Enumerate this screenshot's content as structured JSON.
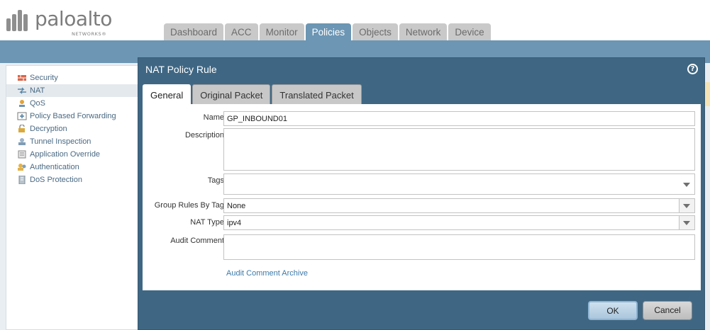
{
  "brand": {
    "name": "paloalto",
    "sub": "NETWORKS®"
  },
  "nav": {
    "tabs": [
      {
        "label": "Dashboard"
      },
      {
        "label": "ACC"
      },
      {
        "label": "Monitor"
      },
      {
        "label": "Policies",
        "active": true
      },
      {
        "label": "Objects"
      },
      {
        "label": "Network"
      },
      {
        "label": "Device"
      }
    ]
  },
  "sidebar": {
    "items": [
      {
        "label": "Security",
        "icon": "security-rule-icon"
      },
      {
        "label": "NAT",
        "icon": "nat-icon",
        "active": true
      },
      {
        "label": "QoS",
        "icon": "qos-icon"
      },
      {
        "label": "Policy Based Forwarding",
        "icon": "pbf-icon"
      },
      {
        "label": "Decryption",
        "icon": "lock-icon"
      },
      {
        "label": "Tunnel Inspection",
        "icon": "tunnel-icon"
      },
      {
        "label": "Application Override",
        "icon": "app-override-icon"
      },
      {
        "label": "Authentication",
        "icon": "users-icon"
      },
      {
        "label": "DoS Protection",
        "icon": "dos-protection-icon"
      }
    ]
  },
  "dialog": {
    "title": "NAT Policy Rule",
    "tabs": [
      {
        "label": "General",
        "active": true
      },
      {
        "label": "Original Packet"
      },
      {
        "label": "Translated Packet"
      }
    ],
    "fields": {
      "name": {
        "label": "Name",
        "value": "GP_INBOUND01"
      },
      "description": {
        "label": "Description",
        "value": ""
      },
      "tags": {
        "label": "Tags",
        "value": ""
      },
      "group_rules_by_tag": {
        "label": "Group Rules By Tag",
        "value": "None"
      },
      "nat_type": {
        "label": "NAT Type",
        "value": "ipv4"
      },
      "audit_comment": {
        "label": "Audit Comment",
        "value": ""
      }
    },
    "audit_comment_archive": "Audit Comment Archive",
    "ok_label": "OK",
    "cancel_label": "Cancel",
    "help_glyph": "?"
  },
  "colors": {
    "accent": "#6c96b4",
    "dialog_bg": "#3f6784",
    "link": "#3d7aa8"
  }
}
